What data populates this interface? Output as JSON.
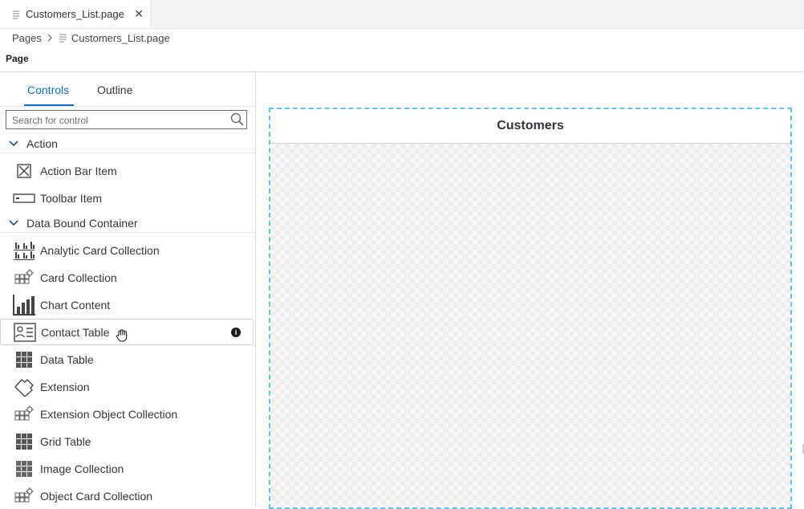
{
  "tab": {
    "label": "Customers_List.page",
    "close": "✕"
  },
  "breadcrumb": {
    "root": "Pages",
    "separator": "›",
    "current": "Customers_List.page"
  },
  "page_label": "Page",
  "panel": {
    "tabs": [
      {
        "label": "Controls",
        "active": true
      },
      {
        "label": "Outline",
        "active": false
      }
    ],
    "search": {
      "value": "",
      "placeholder": "Search for control"
    },
    "groups": [
      {
        "label": "Action",
        "items": [
          {
            "label": "Action Bar Item",
            "icon": "action-bar-item-icon"
          },
          {
            "label": "Toolbar Item",
            "icon": "toolbar-item-icon"
          }
        ]
      },
      {
        "label": "Data Bound Container",
        "items": [
          {
            "label": "Analytic Card Collection",
            "icon": "analytic-card-collection-icon"
          },
          {
            "label": "Card Collection",
            "icon": "card-collection-icon"
          },
          {
            "label": "Chart Content",
            "icon": "chart-content-icon"
          },
          {
            "label": "Contact Table",
            "icon": "contact-table-icon",
            "info": "i"
          },
          {
            "label": "Data Table",
            "icon": "data-table-icon"
          },
          {
            "label": "Extension",
            "icon": "extension-icon"
          },
          {
            "label": "Extension Object Collection",
            "icon": "extension-object-collection-icon"
          },
          {
            "label": "Grid Table",
            "icon": "grid-table-icon"
          },
          {
            "label": "Image Collection",
            "icon": "image-collection-icon"
          },
          {
            "label": "Object Card Collection",
            "icon": "object-card-collection-icon"
          }
        ]
      }
    ]
  },
  "canvas": {
    "title": "Customers"
  },
  "colors": {
    "accent": "#0a6ed1",
    "frame_border": "#5ac4ea"
  }
}
